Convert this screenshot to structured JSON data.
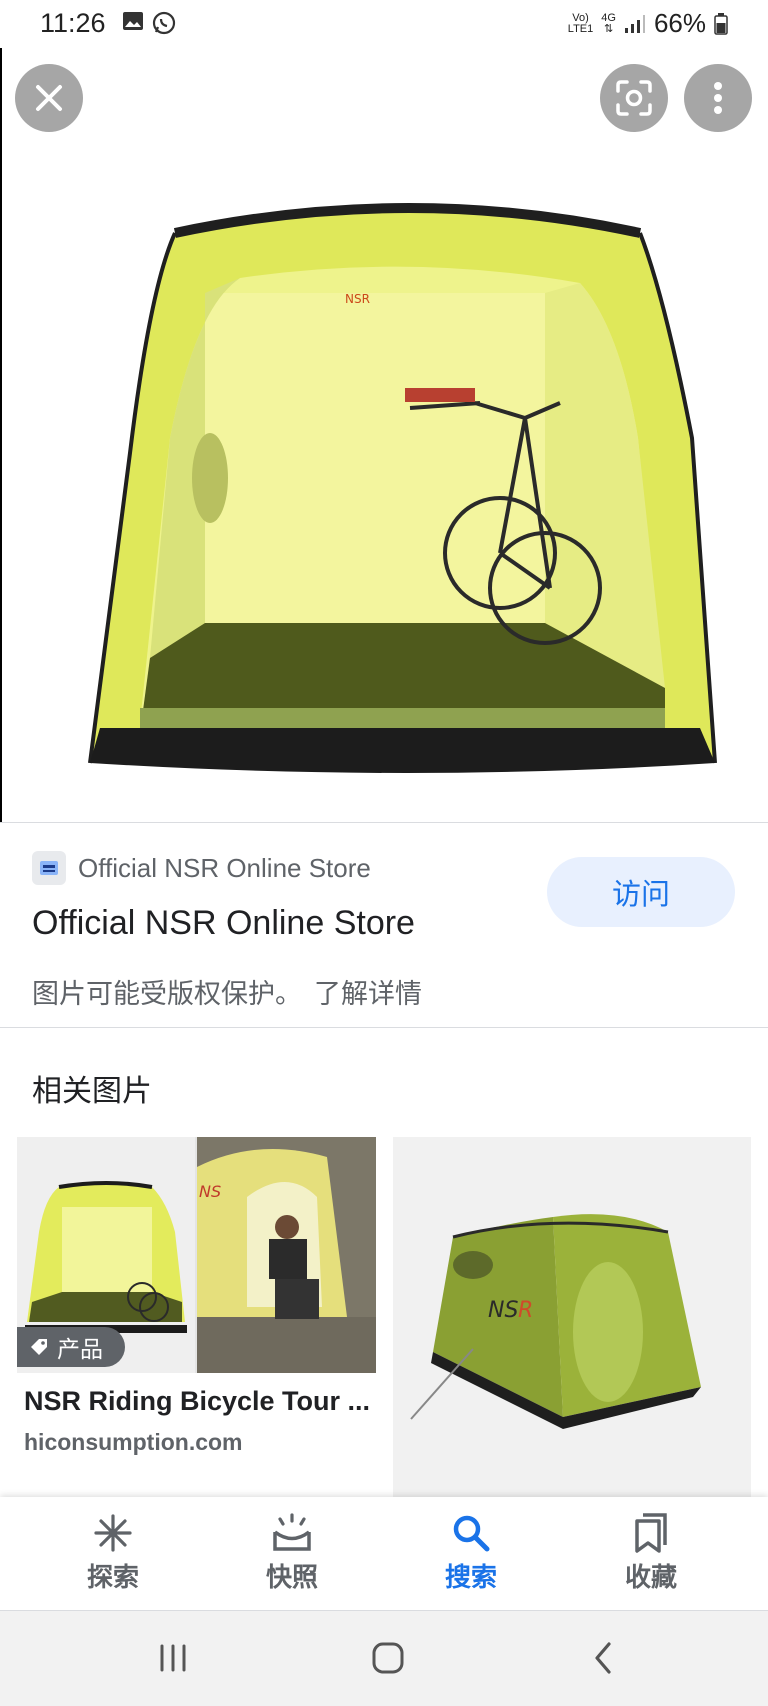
{
  "status_bar": {
    "time": "11:26",
    "battery": "66%",
    "net_top": "Vo)",
    "net_bottom": "LTE1",
    "net_type": "4G",
    "icons": [
      "gallery-icon",
      "whatsapp-icon",
      "signal-icon",
      "battery-icon"
    ]
  },
  "viewer": {
    "close_icon": "close-icon",
    "lens_icon": "lens-icon",
    "more_icon": "more-vert-icon"
  },
  "source": {
    "site_name": "Official NSR Online Store",
    "title": "Official NSR Online Store",
    "visit_label": "访问",
    "copyright_notice": "图片可能受版权保护。",
    "learn_more": "了解详情"
  },
  "related": {
    "heading": "相关图片",
    "results": [
      {
        "badge": "产品",
        "title": "NSR Riding Bicycle Tour ...",
        "domain": "hiconsumption.com"
      }
    ]
  },
  "bottom_nav": {
    "items": [
      {
        "label": "探索",
        "icon": "discover-icon",
        "active": false
      },
      {
        "label": "快照",
        "icon": "snapshot-icon",
        "active": false
      },
      {
        "label": "搜索",
        "icon": "search-icon",
        "active": true
      },
      {
        "label": "收藏",
        "icon": "collections-icon",
        "active": false
      }
    ]
  },
  "colors": {
    "accent": "#1a73e8",
    "visit_bg": "#e8f0fe",
    "tent_yellow": "#e4ee6e",
    "tent_green": "#9bb23a"
  }
}
